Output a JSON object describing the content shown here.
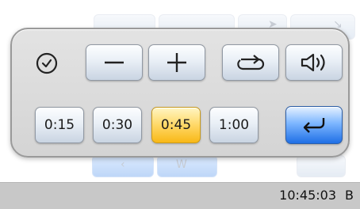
{
  "popup": {
    "time_options": [
      {
        "label": "0:15",
        "selected": false
      },
      {
        "label": "0:30",
        "selected": false
      },
      {
        "label": "0:45",
        "selected": true
      },
      {
        "label": "1:00",
        "selected": false
      }
    ],
    "icons": {
      "clock": "clock-icon",
      "decrease": "minus-icon",
      "increase": "plus-icon",
      "repeat": "repeat-icon",
      "volume": "speaker-icon",
      "confirm": "return-icon"
    }
  },
  "status_bar": {
    "time": "10:45:03",
    "indicator": "B"
  },
  "colors": {
    "selected": "#ffd867",
    "primary": "#1f6fe6",
    "panel": "#d9d9d9"
  }
}
